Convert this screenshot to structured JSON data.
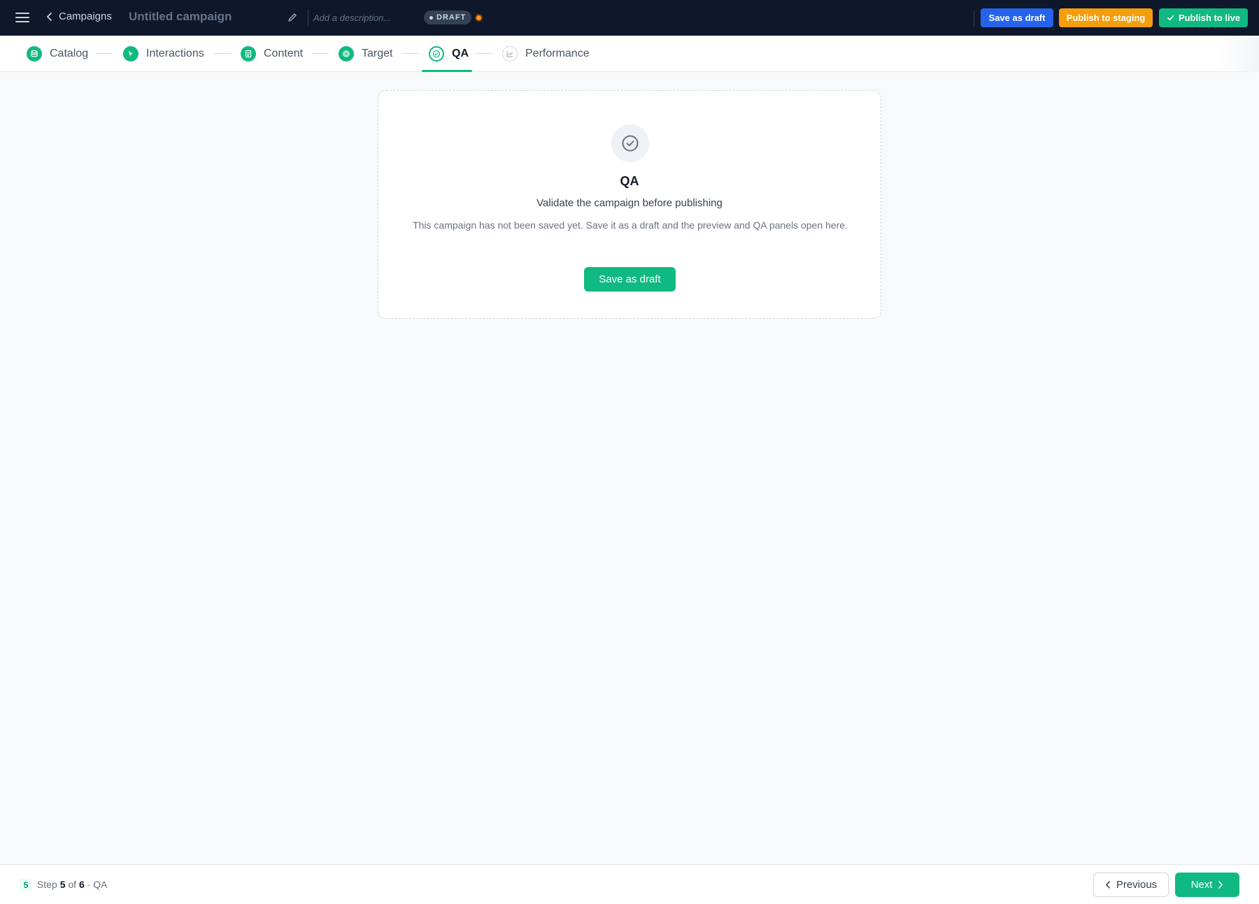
{
  "header": {
    "back_label": "Campaigns",
    "campaign_title": "Untitled campaign",
    "description_placeholder": "Add a description...",
    "status_badge": "DRAFT",
    "actions": {
      "save_draft": "Save as draft",
      "publish_staging": "Publish to staging",
      "publish_live": "Publish to live"
    },
    "colors": {
      "save_draft": "#2563eb",
      "publish_staging": "#f59e0b",
      "publish_live": "#10b981"
    }
  },
  "stepper": {
    "steps": [
      {
        "label": "Catalog",
        "icon": "database-icon",
        "state": "done"
      },
      {
        "label": "Interactions",
        "icon": "cursor-icon",
        "state": "done"
      },
      {
        "label": "Content",
        "icon": "document-icon",
        "state": "done"
      },
      {
        "label": "Target",
        "icon": "target-icon",
        "state": "done"
      },
      {
        "label": "QA",
        "icon": "check-circle-icon",
        "state": "active"
      },
      {
        "label": "Performance",
        "icon": "chart-icon",
        "state": "future"
      }
    ],
    "accent": "#10b981"
  },
  "card": {
    "icon": "check-circle-icon",
    "title": "QA",
    "subtitle": "Validate the campaign before publishing",
    "body": "This campaign has not been saved yet. Save it as a draft and the preview and QA panels open here.",
    "button": "Save as draft"
  },
  "footer": {
    "step_badge": "5",
    "step_word": "Step",
    "current": "5",
    "of_word": "of",
    "total": "6",
    "step_name": "· QA",
    "previous": "Previous",
    "next": "Next"
  }
}
